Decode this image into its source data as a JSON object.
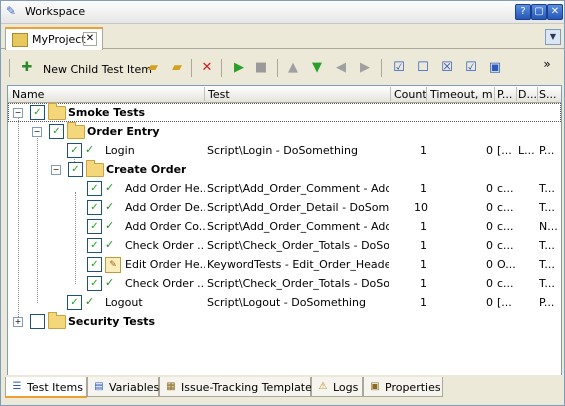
{
  "window": {
    "title": "Workspace",
    "buttons": [
      "?",
      "▢",
      "✕"
    ]
  },
  "doc_tab": {
    "label": "MyProject",
    "close": "✕"
  },
  "toolbar": {
    "new_child_label": "New Child Test Item",
    "overflow": "»"
  },
  "columns": [
    "Name",
    "Test",
    "Count",
    "Timeout, min",
    "P...",
    "D...",
    "S..."
  ],
  "rows": [
    {
      "name": "Smoke Tests",
      "test": "",
      "count": "",
      "timeout": "",
      "p": "",
      "d": "",
      "s": ""
    },
    {
      "name": "Order Entry",
      "test": "",
      "count": "",
      "timeout": "",
      "p": "",
      "d": "",
      "s": ""
    },
    {
      "name": "Login",
      "test": "Script\\Login - DoSomething",
      "count": "1",
      "timeout": "0",
      "p": "[...",
      "d": "L...",
      "s": "P..."
    },
    {
      "name": "Create Order",
      "test": "",
      "count": "",
      "timeout": "",
      "p": "",
      "d": "",
      "s": ""
    },
    {
      "name": "Add Order He...",
      "test": "Script\\Add_Order_Comment - Add...",
      "count": "1",
      "timeout": "0",
      "p": "c...",
      "d": "",
      "s": "T..."
    },
    {
      "name": "Add Order De...",
      "test": "Script\\Add_Order_Detail - DoSomet...",
      "count": "10",
      "timeout": "0",
      "p": "c...",
      "d": "",
      "s": "T..."
    },
    {
      "name": "Add Order Co...",
      "test": "Script\\Add_Order_Comment - Add...",
      "count": "1",
      "timeout": "0",
      "p": "c...",
      "d": "",
      "s": "N..."
    },
    {
      "name": "Check Order ...",
      "test": "Script\\Check_Order_Totals - DoSo...",
      "count": "1",
      "timeout": "0",
      "p": "c...",
      "d": "",
      "s": "T..."
    },
    {
      "name": "Edit Order He...",
      "test": "KeywordTests - Edit_Order_Header",
      "count": "1",
      "timeout": "0",
      "p": "O...",
      "d": "",
      "s": "T..."
    },
    {
      "name": "Check Order ...",
      "test": "Script\\Check_Order_Totals - DoSo...",
      "count": "1",
      "timeout": "0",
      "p": "c...",
      "d": "",
      "s": "T..."
    },
    {
      "name": "Logout",
      "test": "Script\\Logout - DoSomething",
      "count": "1",
      "timeout": "0",
      "p": "[...",
      "d": "",
      "s": "P..."
    },
    {
      "name": "Security Tests",
      "test": "",
      "count": "",
      "timeout": "",
      "p": "",
      "d": "",
      "s": ""
    }
  ],
  "bottom_tabs": [
    "Test Items",
    "Variables",
    "Issue-Tracking Templates",
    "Logs",
    "Properties"
  ],
  "colors": {
    "accent": "#f0a030",
    "check": "#21a121",
    "border": "#7f9db9"
  }
}
